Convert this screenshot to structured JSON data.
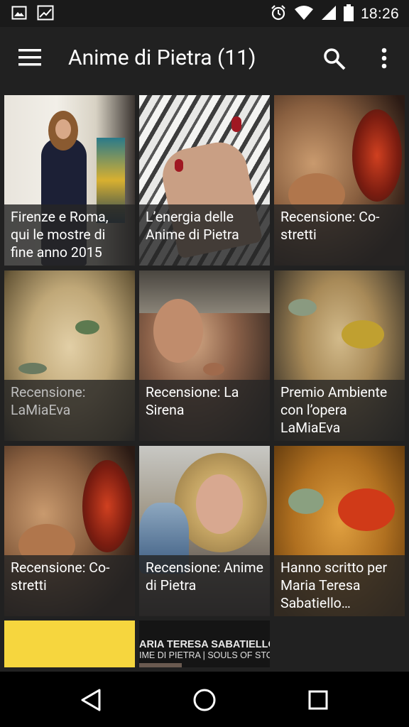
{
  "status_bar": {
    "time": "18:26",
    "left_icons": [
      "image-icon",
      "image-alt-icon"
    ],
    "right_icons": [
      "alarm-icon",
      "wifi-icon",
      "signal-icon",
      "battery-icon"
    ]
  },
  "toolbar": {
    "title": "Anime di Pietra (11)"
  },
  "tiles": [
    {
      "caption": "Firenze e Roma, qui le mostre di fine anno 2015"
    },
    {
      "caption": "L’energia delle Anime di Pietra"
    },
    {
      "caption": "Recensione: Co-stretti"
    },
    {
      "caption": "Recensione: LaMiaEva"
    },
    {
      "caption": "Recensione: La Sirena"
    },
    {
      "caption": "Premio Ambiente con l’opera LaMiaEva"
    },
    {
      "caption": "Recensione: Co-stretti"
    },
    {
      "caption": "Recensione: Anime di Pietra"
    },
    {
      "caption": "Hanno scritto per Maria Teresa Sabatiello…"
    }
  ],
  "partial_tiles": {
    "second_line1": "ARIA TERESA SABATIELLO",
    "second_line2": "IME DI PIETRA | SOULS OF STON"
  }
}
